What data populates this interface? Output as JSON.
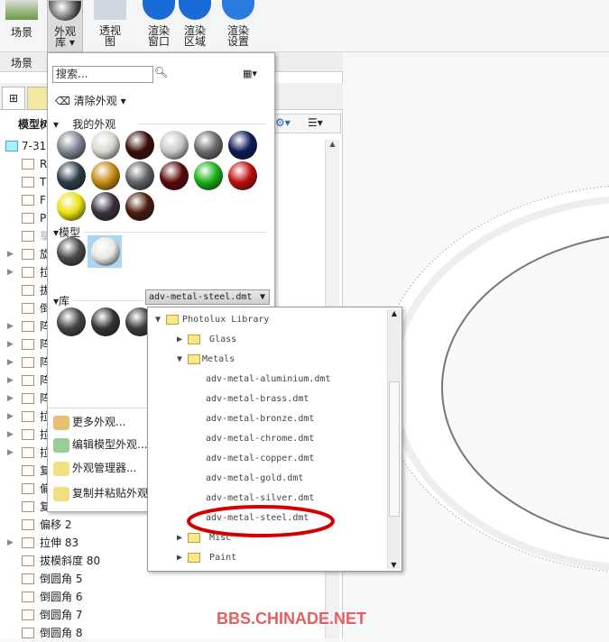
{
  "ribbon": {
    "buttons": [
      {
        "label": "场景"
      },
      {
        "label": "外观\n库",
        "l1": "外观",
        "l2": "库 ▾"
      },
      {
        "l1": "透视",
        "l2": "图"
      },
      {
        "l1": "渲染",
        "l2": "窗口"
      },
      {
        "l1": "渲染",
        "l2": "区域"
      },
      {
        "l1": "渲染",
        "l2": "设置"
      }
    ],
    "group_label": "场景"
  },
  "model_tree": {
    "header": "模型树",
    "items": [
      {
        "label": "7-31",
        "expand": false
      },
      {
        "label": "R"
      },
      {
        "label": "T"
      },
      {
        "label": "F"
      },
      {
        "label": "P"
      },
      {
        "label": "草"
      },
      {
        "label": "旋",
        "expand": true
      },
      {
        "label": "拉",
        "expand": true
      },
      {
        "label": "拔"
      },
      {
        "label": "倒"
      },
      {
        "label": "阵",
        "expand": true
      },
      {
        "label": "阵",
        "expand": true
      },
      {
        "label": "阵",
        "expand": true
      },
      {
        "label": "阵",
        "expand": true
      },
      {
        "label": "阵",
        "expand": true
      },
      {
        "label": "拉",
        "expand": true
      },
      {
        "label": "拉",
        "expand": true
      },
      {
        "label": "拉",
        "expand": true
      },
      {
        "label": "复"
      },
      {
        "label": "偏"
      },
      {
        "label": "复"
      },
      {
        "label": "偏移 2"
      },
      {
        "label": "拉伸 83",
        "expand": true
      },
      {
        "label": "拔模斜度 80"
      },
      {
        "label": "倒圆角 5"
      },
      {
        "label": "倒圆角 6"
      },
      {
        "label": "倒圆角 7"
      },
      {
        "label": "倒圆角 8"
      }
    ]
  },
  "appearance_menu": {
    "search_placeholder": "搜索...",
    "clear_label": "清除外观",
    "my_section": "我的外观",
    "model_section": "模型",
    "library_section": "库",
    "my_swatches": [
      "#7d8590",
      "#d8d8d0",
      "#3a0e08",
      "#c8c8c8",
      "#6a6a6a",
      "#0b1a5a",
      "#2c3d48",
      "#c68a10",
      "#5d6266",
      "#5a0a0a",
      "#18b018",
      "#c00c0c",
      "#e8e010",
      "#3a3040",
      "#4a1a0a"
    ],
    "model_swatches": [
      "#4a4a4a",
      "#e8e8e0"
    ],
    "library_swatches": [
      "#444",
      "#333",
      "#3a3a3a"
    ],
    "menu_items": [
      "更多外观...",
      "编辑模型外观...",
      "外观管理器...",
      "复制并粘贴外观"
    ]
  },
  "library_popup": {
    "selected": "adv-metal-steel.dmt",
    "root": "Photolux Library",
    "folders": [
      "Glass",
      "Metals",
      "Misc",
      "Paint"
    ],
    "metals": [
      "adv-metal-aluminium.dmt",
      "adv-metal-brass.dmt",
      "adv-metal-bronze.dmt",
      "adv-metal-chrome.dmt",
      "adv-metal-copper.dmt",
      "adv-metal-gold.dmt",
      "adv-metal-silver.dmt",
      "adv-metal-steel.dmt"
    ]
  },
  "watermark": "BBS.CHINADE.NET"
}
